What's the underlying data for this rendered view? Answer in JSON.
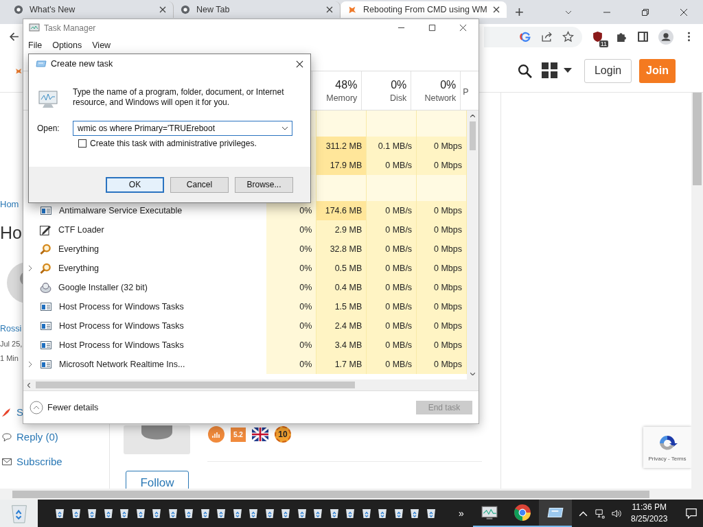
{
  "browser": {
    "tabs": [
      {
        "title": "What's New",
        "selected": false
      },
      {
        "title": "New Tab",
        "selected": false
      },
      {
        "title": "Rebooting From CMD using WM",
        "selected": true
      }
    ],
    "new_tab": "+",
    "extension_badge": "11",
    "login": "Login",
    "join": "Join"
  },
  "page": {
    "breadcrumb": "Hom",
    "title": "Ho",
    "author": "Rossi",
    "date": "Jul 25,",
    "read_time": "1 Min",
    "actions": [
      {
        "kind": "share",
        "label": "S"
      },
      {
        "kind": "reply",
        "label": "Reply (0)"
      },
      {
        "kind": "subscribe",
        "label": "Subscribe"
      }
    ],
    "badges": [
      {
        "kind": "medal"
      },
      {
        "kind": "level",
        "text": "5.2"
      },
      {
        "kind": "flag"
      },
      {
        "kind": "rank",
        "text": "10"
      }
    ],
    "follow": "Follow",
    "recaptcha": "Privacy - Terms"
  },
  "task_manager": {
    "title": "Task Manager",
    "menu": [
      "File",
      "Options",
      "View"
    ],
    "columns": [
      {
        "percent": "48%",
        "label": "Memory"
      },
      {
        "percent": "0%",
        "label": "Disk"
      },
      {
        "percent": "0%",
        "label": "Network"
      },
      {
        "label": "P"
      }
    ],
    "rows": [
      {
        "kind": "group"
      },
      {
        "kind": "hidden",
        "memory": "311.2 MB",
        "memory_high": true,
        "disk": "0.1 MB/s",
        "network": "0 Mbps"
      },
      {
        "kind": "hidden",
        "memory": "17.9 MB",
        "memory_high": true,
        "disk": "0 MB/s",
        "network": "0 Mbps"
      },
      {
        "kind": "group"
      },
      {
        "kind": "window",
        "name": "Antimalware Service Executable",
        "expandable": false,
        "cpu": "0%",
        "memory": "174.6 MB",
        "memory_high": true,
        "disk": "0 MB/s",
        "network": "0 Mbps"
      },
      {
        "kind": "pen",
        "name": "CTF Loader",
        "expandable": false,
        "cpu": "0%",
        "memory": "2.9 MB",
        "memory_high": false,
        "disk": "0 MB/s",
        "network": "0 Mbps"
      },
      {
        "kind": "magnifier",
        "name": "Everything",
        "expandable": false,
        "cpu": "0%",
        "memory": "32.8 MB",
        "memory_high": false,
        "disk": "0 MB/s",
        "network": "0 Mbps"
      },
      {
        "kind": "magnifier",
        "name": "Everything",
        "expandable": true,
        "cpu": "0%",
        "memory": "0.5 MB",
        "memory_high": false,
        "disk": "0 MB/s",
        "network": "0 Mbps"
      },
      {
        "kind": "installer",
        "name": "Google Installer (32 bit)",
        "expandable": false,
        "cpu": "0%",
        "memory": "0.4 MB",
        "memory_high": false,
        "disk": "0 MB/s",
        "network": "0 Mbps"
      },
      {
        "kind": "window",
        "name": "Host Process for Windows Tasks",
        "expandable": false,
        "cpu": "0%",
        "memory": "1.5 MB",
        "memory_high": false,
        "disk": "0 MB/s",
        "network": "0 Mbps"
      },
      {
        "kind": "window",
        "name": "Host Process for Windows Tasks",
        "expandable": false,
        "cpu": "0%",
        "memory": "2.4 MB",
        "memory_high": false,
        "disk": "0 MB/s",
        "network": "0 Mbps"
      },
      {
        "kind": "window",
        "name": "Host Process for Windows Tasks",
        "expandable": false,
        "cpu": "0%",
        "memory": "3.4 MB",
        "memory_high": false,
        "disk": "0 MB/s",
        "network": "0 Mbps"
      },
      {
        "kind": "window",
        "name": "Microsoft Network Realtime Ins...",
        "expandable": true,
        "cpu": "0%",
        "memory": "1.7 MB",
        "memory_high": false,
        "disk": "0 MB/s",
        "network": "0 Mbps"
      }
    ],
    "fewer_details": "Fewer details",
    "end_task": {
      "label": "End task",
      "disabled": true
    }
  },
  "dialog": {
    "title": "Create new task",
    "message": "Type the name of a program, folder, document, or Internet resource, and Windows will open it for you.",
    "open_label": "Open:",
    "value": "wmic os where Primary='TRUEreboot",
    "admin": {
      "label": "Create this task with administrative privileges.",
      "checked": false
    },
    "buttons": [
      {
        "label": "OK",
        "default": true
      },
      {
        "label": "Cancel",
        "default": false
      },
      {
        "label": "Browse...",
        "default": false
      }
    ]
  },
  "taskbar": {
    "pinned": [
      {
        "kind": "bin"
      },
      {
        "kind": "bin"
      },
      {
        "kind": "bin"
      },
      {
        "kind": "bin"
      },
      {
        "kind": "bin"
      },
      {
        "kind": "bin"
      },
      {
        "kind": "bin"
      },
      {
        "kind": "bin"
      },
      {
        "kind": "bin"
      },
      {
        "kind": "bin"
      },
      {
        "kind": "bin"
      },
      {
        "kind": "bin"
      },
      {
        "kind": "bin"
      },
      {
        "kind": "bin"
      },
      {
        "kind": "bin"
      },
      {
        "kind": "bin"
      },
      {
        "kind": "bin"
      },
      {
        "kind": "bin"
      },
      {
        "kind": "bin"
      },
      {
        "kind": "bin"
      },
      {
        "kind": "bin"
      },
      {
        "kind": "bin"
      },
      {
        "kind": "bin"
      },
      {
        "kind": "bin"
      }
    ],
    "overflow": "»",
    "apps": [
      {
        "kind": "monitor",
        "active": false
      },
      {
        "kind": "chrome",
        "active": false
      },
      {
        "kind": "run",
        "active": true
      }
    ],
    "time": "11:36 PM",
    "date": "8/25/2023"
  }
}
